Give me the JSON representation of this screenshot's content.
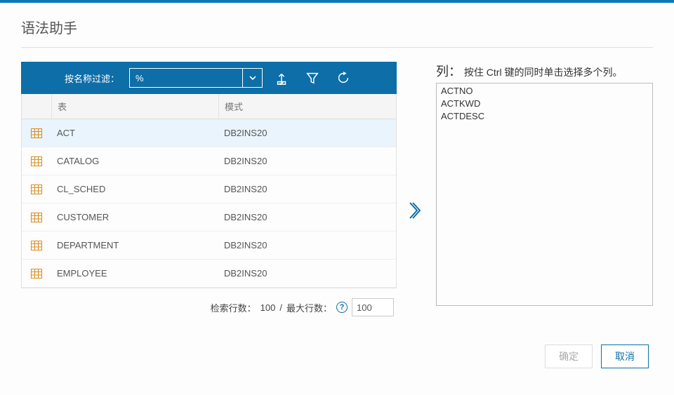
{
  "title": "语法助手",
  "toolbar": {
    "filter_label": "按名称过滤：",
    "filter_value": "%"
  },
  "table": {
    "headers": {
      "name": "表",
      "schema": "模式"
    },
    "rows": [
      {
        "name": "ACT",
        "schema": "DB2INS20",
        "selected": true
      },
      {
        "name": "CATALOG",
        "schema": "DB2INS20",
        "selected": false
      },
      {
        "name": "CL_SCHED",
        "schema": "DB2INS20",
        "selected": false
      },
      {
        "name": "CUSTOMER",
        "schema": "DB2INS20",
        "selected": false
      },
      {
        "name": "DEPARTMENT",
        "schema": "DB2INS20",
        "selected": false
      },
      {
        "name": "EMPLOYEE",
        "schema": "DB2INS20",
        "selected": false
      }
    ]
  },
  "footer": {
    "retrieved_label": "检索行数：",
    "retrieved_value": "100",
    "sep": " / ",
    "maxrows_label": "最大行数：",
    "maxrows_value": "100"
  },
  "right": {
    "label_big": "列：",
    "label_hint": " 按住 Ctrl 键的同时单击选择多个列。",
    "columns": [
      "ACTNO",
      "ACTKWD",
      "ACTDESC"
    ]
  },
  "buttons": {
    "ok": "确定",
    "cancel": "取消"
  }
}
